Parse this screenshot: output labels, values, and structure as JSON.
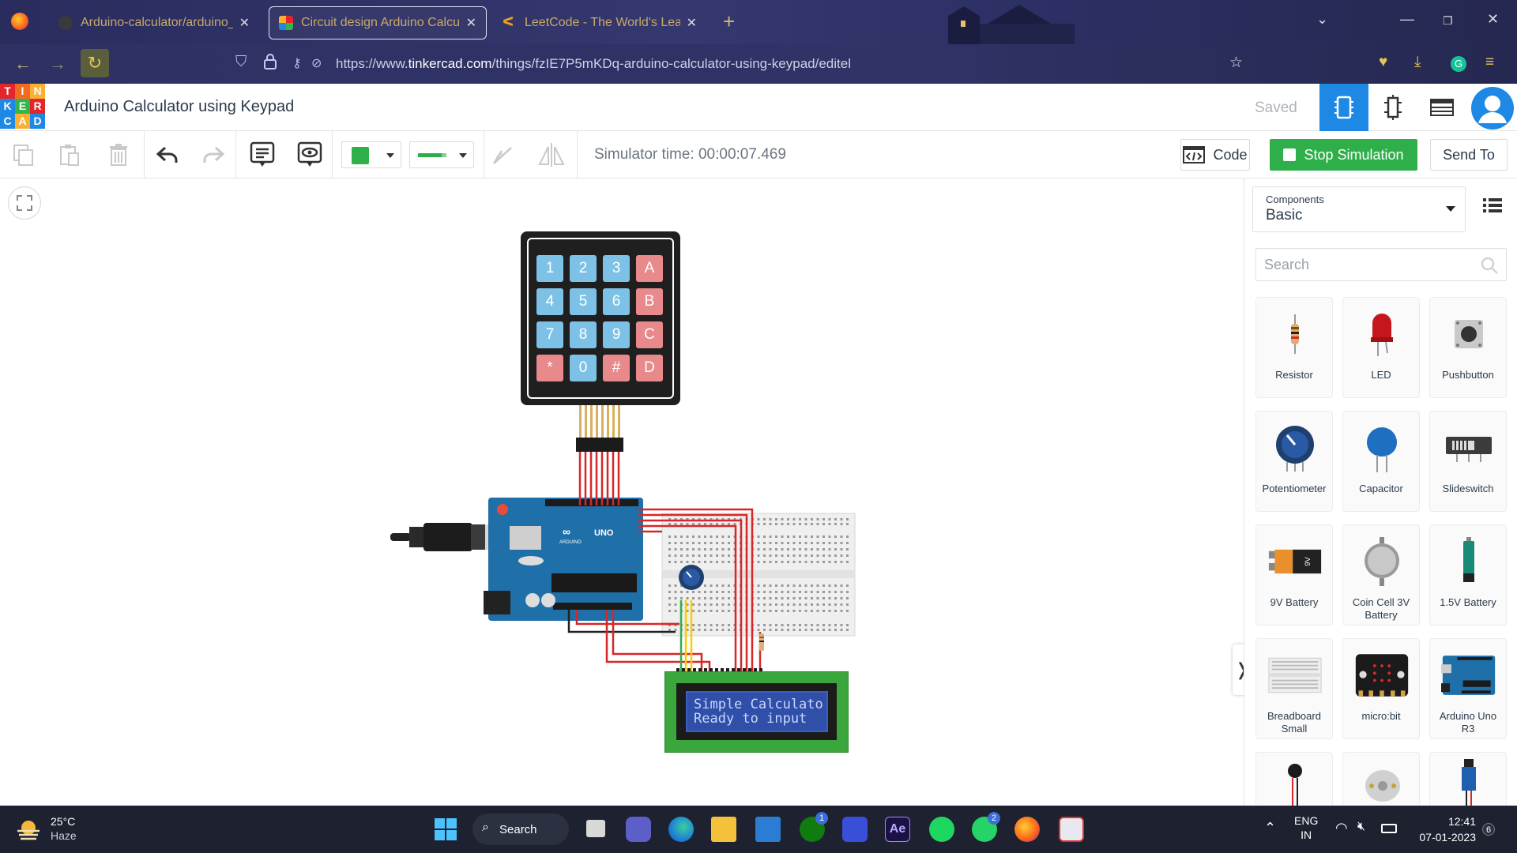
{
  "browser": {
    "tabs": [
      {
        "title": "Arduino-calculator/arduino_cal",
        "active": false
      },
      {
        "title": "Circuit design Arduino Calculat",
        "active": true
      },
      {
        "title": "LeetCode - The World's Leadin",
        "active": false
      }
    ],
    "url_prefix": "https://www.",
    "url_domain": "tinkercad.com",
    "url_path": "/things/fzIE7P5mKDq-arduino-calculator-using-keypad/editel"
  },
  "header": {
    "logo_letters": [
      "T",
      "I",
      "N",
      "K",
      "E",
      "R",
      "C",
      "A",
      "D"
    ],
    "logo_colors": [
      "#e4262b",
      "#f26b21",
      "#fbb034",
      "#1e88e5",
      "#35b44a",
      "#e4262b",
      "#1e88e5",
      "#fbb034",
      "#1e88e5"
    ],
    "project_title": "Arduino Calculator using Keypad",
    "status": "Saved"
  },
  "toolbar": {
    "simulator_time": "Simulator time: 00:00:07.469",
    "code_label": "Code",
    "stop_label": "Stop Simulation",
    "send_label": "Send To",
    "fill_color": "#2eaf4a",
    "wire_color": "#2eaf4a"
  },
  "canvas": {
    "keypad_keys": [
      "1",
      "2",
      "3",
      "A",
      "4",
      "5",
      "6",
      "B",
      "7",
      "8",
      "9",
      "C",
      "*",
      "0",
      "#",
      "D"
    ],
    "arduino_label": "UNO",
    "arduino_brand": "ARDUINO",
    "lcd_line1": "Simple Calculato",
    "lcd_line2": "Ready to input"
  },
  "panel": {
    "components_label": "Components",
    "components_value": "Basic",
    "search_placeholder": "Search",
    "components": [
      {
        "name": "Resistor",
        "icon": "resistor-icon"
      },
      {
        "name": "LED",
        "icon": "led-icon"
      },
      {
        "name": "Pushbutton",
        "icon": "pushbutton-icon"
      },
      {
        "name": "Potentiometer",
        "icon": "potentiometer-icon"
      },
      {
        "name": "Capacitor",
        "icon": "capacitor-icon"
      },
      {
        "name": "Slideswitch",
        "icon": "slideswitch-icon"
      },
      {
        "name": "9V Battery",
        "icon": "battery-9v-icon"
      },
      {
        "name": "Coin Cell 3V Battery",
        "icon": "coin-cell-icon"
      },
      {
        "name": "1.5V Battery",
        "icon": "battery-aa-icon"
      },
      {
        "name": "Breadboard Small",
        "icon": "breadboard-icon"
      },
      {
        "name": "micro:bit",
        "icon": "microbit-icon"
      },
      {
        "name": "Arduino Uno R3",
        "icon": "arduino-icon"
      }
    ]
  },
  "taskbar": {
    "temperature": "25°C",
    "weather": "Haze",
    "search_label": "Search",
    "lang1": "ENG",
    "lang2": "IN",
    "time": "12:41",
    "date": "07-01-2023",
    "notif_count": "6",
    "xbox_badge": "1",
    "whatsapp_badge": "2"
  }
}
